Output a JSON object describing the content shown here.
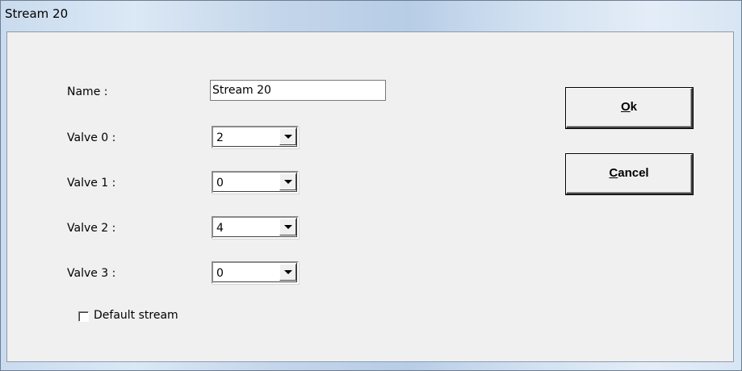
{
  "window": {
    "title": "Stream 20"
  },
  "form": {
    "name_label": "Name :",
    "name_value": "Stream 20",
    "valves": [
      {
        "label": "Valve 0 :",
        "value": "2"
      },
      {
        "label": "Valve 1 :",
        "value": "0"
      },
      {
        "label": "Valve 2 :",
        "value": "4"
      },
      {
        "label": "Valve 3 :",
        "value": "0"
      }
    ],
    "default_stream_label": "Default stream",
    "default_stream_checked": false
  },
  "buttons": {
    "ok_mnemonic": "O",
    "ok_rest": "k",
    "cancel_mnemonic": "C",
    "cancel_rest": "ancel"
  },
  "icons": {
    "dropdown": "chevron-down-icon"
  }
}
